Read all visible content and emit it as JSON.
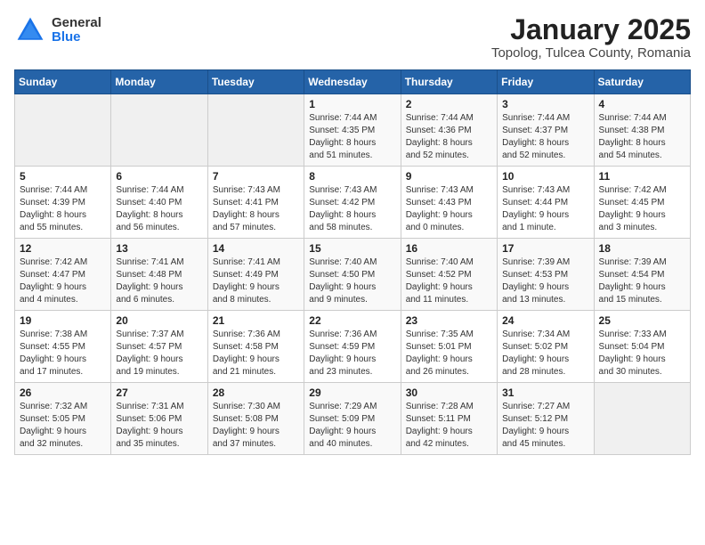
{
  "header": {
    "logo_general": "General",
    "logo_blue": "Blue",
    "month": "January 2025",
    "location": "Topolog, Tulcea County, Romania"
  },
  "weekdays": [
    "Sunday",
    "Monday",
    "Tuesday",
    "Wednesday",
    "Thursday",
    "Friday",
    "Saturday"
  ],
  "weeks": [
    [
      {
        "day": "",
        "info": ""
      },
      {
        "day": "",
        "info": ""
      },
      {
        "day": "",
        "info": ""
      },
      {
        "day": "1",
        "info": "Sunrise: 7:44 AM\nSunset: 4:35 PM\nDaylight: 8 hours\nand 51 minutes."
      },
      {
        "day": "2",
        "info": "Sunrise: 7:44 AM\nSunset: 4:36 PM\nDaylight: 8 hours\nand 52 minutes."
      },
      {
        "day": "3",
        "info": "Sunrise: 7:44 AM\nSunset: 4:37 PM\nDaylight: 8 hours\nand 52 minutes."
      },
      {
        "day": "4",
        "info": "Sunrise: 7:44 AM\nSunset: 4:38 PM\nDaylight: 8 hours\nand 54 minutes."
      }
    ],
    [
      {
        "day": "5",
        "info": "Sunrise: 7:44 AM\nSunset: 4:39 PM\nDaylight: 8 hours\nand 55 minutes."
      },
      {
        "day": "6",
        "info": "Sunrise: 7:44 AM\nSunset: 4:40 PM\nDaylight: 8 hours\nand 56 minutes."
      },
      {
        "day": "7",
        "info": "Sunrise: 7:43 AM\nSunset: 4:41 PM\nDaylight: 8 hours\nand 57 minutes."
      },
      {
        "day": "8",
        "info": "Sunrise: 7:43 AM\nSunset: 4:42 PM\nDaylight: 8 hours\nand 58 minutes."
      },
      {
        "day": "9",
        "info": "Sunrise: 7:43 AM\nSunset: 4:43 PM\nDaylight: 9 hours\nand 0 minutes."
      },
      {
        "day": "10",
        "info": "Sunrise: 7:43 AM\nSunset: 4:44 PM\nDaylight: 9 hours\nand 1 minute."
      },
      {
        "day": "11",
        "info": "Sunrise: 7:42 AM\nSunset: 4:45 PM\nDaylight: 9 hours\nand 3 minutes."
      }
    ],
    [
      {
        "day": "12",
        "info": "Sunrise: 7:42 AM\nSunset: 4:47 PM\nDaylight: 9 hours\nand 4 minutes."
      },
      {
        "day": "13",
        "info": "Sunrise: 7:41 AM\nSunset: 4:48 PM\nDaylight: 9 hours\nand 6 minutes."
      },
      {
        "day": "14",
        "info": "Sunrise: 7:41 AM\nSunset: 4:49 PM\nDaylight: 9 hours\nand 8 minutes."
      },
      {
        "day": "15",
        "info": "Sunrise: 7:40 AM\nSunset: 4:50 PM\nDaylight: 9 hours\nand 9 minutes."
      },
      {
        "day": "16",
        "info": "Sunrise: 7:40 AM\nSunset: 4:52 PM\nDaylight: 9 hours\nand 11 minutes."
      },
      {
        "day": "17",
        "info": "Sunrise: 7:39 AM\nSunset: 4:53 PM\nDaylight: 9 hours\nand 13 minutes."
      },
      {
        "day": "18",
        "info": "Sunrise: 7:39 AM\nSunset: 4:54 PM\nDaylight: 9 hours\nand 15 minutes."
      }
    ],
    [
      {
        "day": "19",
        "info": "Sunrise: 7:38 AM\nSunset: 4:55 PM\nDaylight: 9 hours\nand 17 minutes."
      },
      {
        "day": "20",
        "info": "Sunrise: 7:37 AM\nSunset: 4:57 PM\nDaylight: 9 hours\nand 19 minutes."
      },
      {
        "day": "21",
        "info": "Sunrise: 7:36 AM\nSunset: 4:58 PM\nDaylight: 9 hours\nand 21 minutes."
      },
      {
        "day": "22",
        "info": "Sunrise: 7:36 AM\nSunset: 4:59 PM\nDaylight: 9 hours\nand 23 minutes."
      },
      {
        "day": "23",
        "info": "Sunrise: 7:35 AM\nSunset: 5:01 PM\nDaylight: 9 hours\nand 26 minutes."
      },
      {
        "day": "24",
        "info": "Sunrise: 7:34 AM\nSunset: 5:02 PM\nDaylight: 9 hours\nand 28 minutes."
      },
      {
        "day": "25",
        "info": "Sunrise: 7:33 AM\nSunset: 5:04 PM\nDaylight: 9 hours\nand 30 minutes."
      }
    ],
    [
      {
        "day": "26",
        "info": "Sunrise: 7:32 AM\nSunset: 5:05 PM\nDaylight: 9 hours\nand 32 minutes."
      },
      {
        "day": "27",
        "info": "Sunrise: 7:31 AM\nSunset: 5:06 PM\nDaylight: 9 hours\nand 35 minutes."
      },
      {
        "day": "28",
        "info": "Sunrise: 7:30 AM\nSunset: 5:08 PM\nDaylight: 9 hours\nand 37 minutes."
      },
      {
        "day": "29",
        "info": "Sunrise: 7:29 AM\nSunset: 5:09 PM\nDaylight: 9 hours\nand 40 minutes."
      },
      {
        "day": "30",
        "info": "Sunrise: 7:28 AM\nSunset: 5:11 PM\nDaylight: 9 hours\nand 42 minutes."
      },
      {
        "day": "31",
        "info": "Sunrise: 7:27 AM\nSunset: 5:12 PM\nDaylight: 9 hours\nand 45 minutes."
      },
      {
        "day": "",
        "info": ""
      }
    ]
  ]
}
